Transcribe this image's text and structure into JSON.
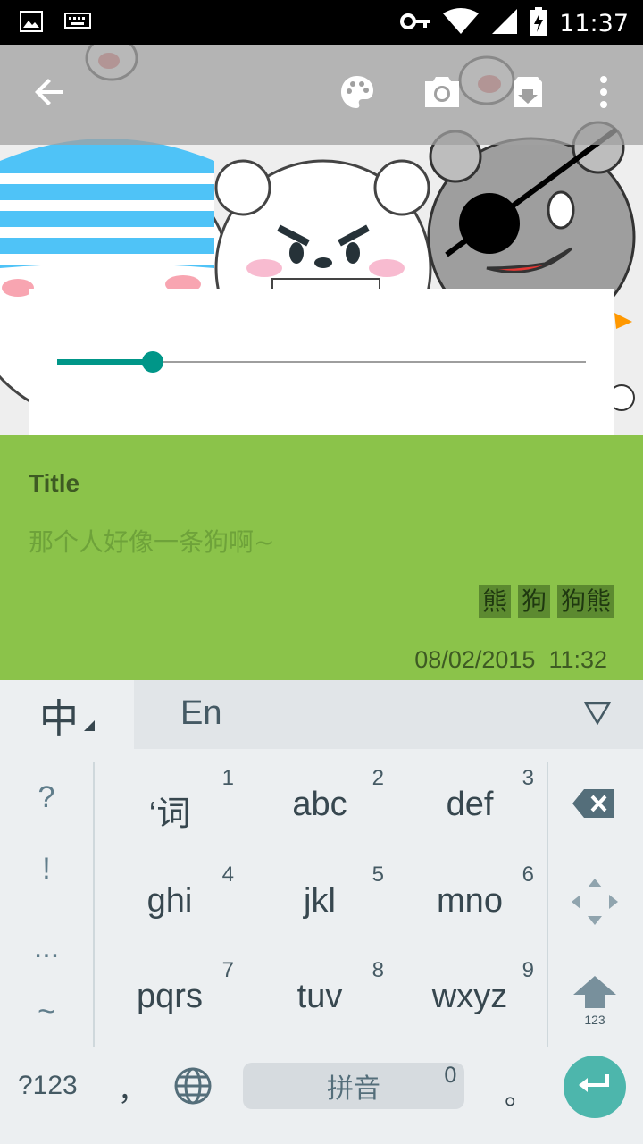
{
  "status_bar": {
    "time": "11:37"
  },
  "toolbar": {
    "back_icon": "arrow-back-icon",
    "palette_icon": "palette-icon",
    "camera_icon": "camera-icon",
    "archive_icon": "archive-icon",
    "more_icon": "more-vert-icon"
  },
  "slider": {
    "value_fraction": 0.18,
    "color": "#009688"
  },
  "note": {
    "title": "Title",
    "body": "那个人好像一条狗啊~",
    "tags": [
      "熊",
      "狗",
      "狗熊"
    ],
    "date": "08/02/2015",
    "time": "11:32",
    "background": "#8bc34a"
  },
  "keyboard": {
    "lang_zh": "中",
    "lang_en": "En",
    "symbols": [
      "?",
      "!",
      "...",
      "~"
    ],
    "keys": [
      {
        "label": "‘词",
        "num": "1"
      },
      {
        "label": "abc",
        "num": "2"
      },
      {
        "label": "def",
        "num": "3"
      },
      {
        "label": "ghi",
        "num": "4"
      },
      {
        "label": "jkl",
        "num": "5"
      },
      {
        "label": "mno",
        "num": "6"
      },
      {
        "label": "pqrs",
        "num": "7"
      },
      {
        "label": "tuv",
        "num": "8"
      },
      {
        "label": "wxyz",
        "num": "9"
      }
    ],
    "shift_label": "123",
    "mode_key": "?123",
    "comma": "，",
    "space_label": "拼音",
    "space_num": "0",
    "period": "。"
  }
}
